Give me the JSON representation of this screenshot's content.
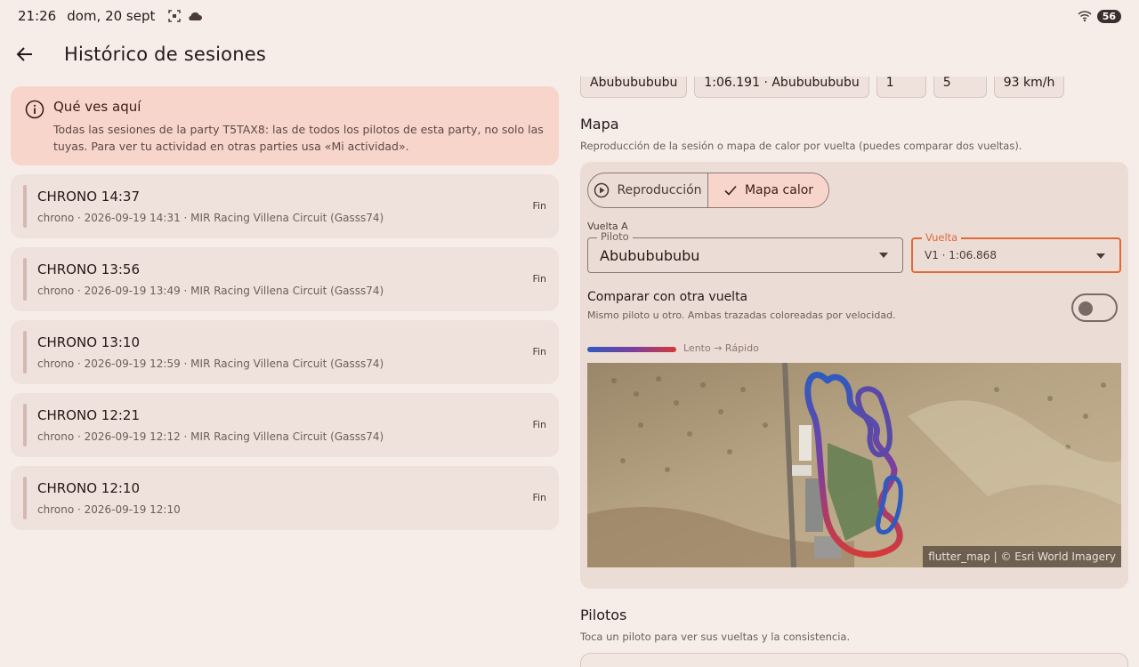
{
  "status_bar": {
    "time": "21:26",
    "date": "dom, 20 sept",
    "battery": "56"
  },
  "app_bar": {
    "title": "Histórico de sesiones"
  },
  "info_card": {
    "title": "Qué ves aquí",
    "body": "Todas las sesiones de la party T5TAX8: las de todos los pilotos de esta party, no solo las tuyas. Para ver tu actividad en otras parties usa «Mi actividad»."
  },
  "sessions": [
    {
      "title": "CHRONO 14:37",
      "subtitle": "chrono · 2026-09-19 14:31 · MIR Racing Villena Circuit (Gasss74)",
      "status": "Fin"
    },
    {
      "title": "CHRONO 13:56",
      "subtitle": "chrono · 2026-09-19 13:49 · MIR Racing Villena Circuit (Gasss74)",
      "status": "Fin"
    },
    {
      "title": "CHRONO 13:10",
      "subtitle": "chrono · 2026-09-19 12:59 · MIR Racing Villena Circuit (Gasss74)",
      "status": "Fin"
    },
    {
      "title": "CHRONO 12:21",
      "subtitle": "chrono · 2026-09-19 12:12 · MIR Racing Villena Circuit (Gasss74)",
      "status": "Fin"
    },
    {
      "title": "CHRONO 12:10",
      "subtitle": "chrono · 2026-09-19 12:10",
      "status": "Fin"
    }
  ],
  "summary_chips": [
    "Abububububu",
    "1:06.191 · Abububububu",
    "1",
    "5",
    "93 km/h"
  ],
  "map_section": {
    "title": "Mapa",
    "subtitle": "Reproducción de la sesión o mapa de calor por vuelta (puedes comparar dos vueltas).",
    "mode_replay": "Reproducción",
    "mode_heatmap": "Mapa calor",
    "lap_a_label": "Vuelta A",
    "pilot_label": "Piloto",
    "pilot_value": "Abububububu",
    "lap_label": "Vuelta",
    "lap_value": "V1 · 1:06.868",
    "compare_title": "Comparar con otra vuelta",
    "compare_sub": "Mismo piloto u otro. Ambas trazadas coloreadas por velocidad.",
    "compare_enabled": false,
    "legend": "Lento → Rápido",
    "attribution": "flutter_map | © Esri World Imagery",
    "colors": {
      "slow": "#2f5bbf",
      "fast": "#d43a3a",
      "accent": "#e06a35"
    }
  },
  "pilots_section": {
    "title": "Pilotos",
    "subtitle": "Toca un piloto para ver sus vueltas y la consistencia."
  }
}
